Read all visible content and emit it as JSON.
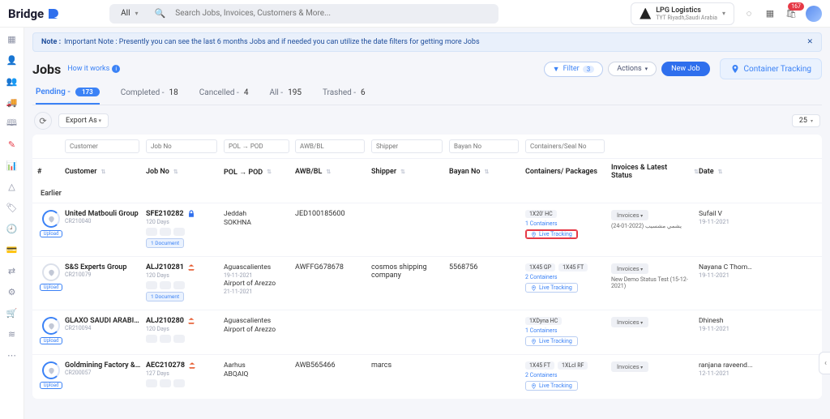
{
  "brand": "Bridge",
  "search": {
    "scope": "All",
    "placeholder": "Search Jobs, Invoices, Customers & More..."
  },
  "tenant": {
    "name": "LPG Logistics",
    "location": "TYT Riyadh,Saudi Arabia"
  },
  "notif_badge": "167",
  "notice": {
    "label": "Note :",
    "text": "Important Note : Presently you can see the last 6 months Jobs and if needed you can utilize the date filters for getting more Jobs"
  },
  "page_title": "Jobs",
  "how_it_works": "How it works",
  "filter": {
    "label": "Filter",
    "count": "3"
  },
  "actions_label": "Actions",
  "new_job": "New Job",
  "container_tracking": "Container Tracking",
  "tabs": {
    "pending": {
      "label": "Pending -",
      "count": "173"
    },
    "completed": {
      "label": "Completed -",
      "count": "18"
    },
    "cancelled": {
      "label": "Cancelled -",
      "count": "4"
    },
    "all": {
      "label": "All -",
      "count": "195"
    },
    "trashed": {
      "label": "Trashed -",
      "count": "6"
    }
  },
  "export_label": "Export As",
  "page_size": "25",
  "filters": {
    "customer": "Customer",
    "jobno": "Job No",
    "polpod": "POL → POD",
    "awb": "AWB/BL",
    "shipper": "Shipper",
    "bayan": "Bayan No",
    "container": "Containers/Seal No"
  },
  "columns": {
    "hash": "#",
    "customer": "Customer",
    "jobno": "Job No",
    "polpod": "POL → POD",
    "awb": "AWB/BL",
    "shipper": "Shipper",
    "bayan": "Bayan No",
    "containers": "Containers/ Packages",
    "invoices": "Invoices & Latest Status",
    "date": "Date"
  },
  "section_label": "Earlier",
  "upload_label": "Upload",
  "invoices_chip": "Invoices",
  "live_tracking": "Live Tracking",
  "doc_chip": "1 Document",
  "rows": [
    {
      "customer": "United Matbouli Group",
      "code": "CR210040",
      "jobno": "SFE210282",
      "mode": "sea-blue",
      "days": "120 Days",
      "pol": "Jeddah",
      "pod": "SOKHNA",
      "pol_sub": "",
      "awb": "JED100185600",
      "shipper": "",
      "bayan": "",
      "sizes": [
        "1X20' HC"
      ],
      "cont_count": "1 Containers",
      "lt_hl": true,
      "inv_sub": "يشمي مشسيب (2022-01-24)",
      "user": "Sufail V",
      "date": "19-11-2021",
      "doc": true,
      "ring_active": true
    },
    {
      "customer": "S&S Experts Group",
      "code": "CR210079",
      "jobno": "ALJ210281",
      "mode": "sea-red",
      "days": "120 Days",
      "pol": "Aguascalientes",
      "pod": "Airport of Arezzo",
      "pol_sub": "19-11-2021",
      "pod_sub": "21-11-2021",
      "awb": "AWFFG678678",
      "shipper": "cosmos shipping company",
      "bayan": "5568756",
      "sizes": [
        "1X45 GP",
        "1X45 FT"
      ],
      "cont_count": "2 Containers",
      "lt_hl": false,
      "inv_sub": "New Demo Status Test (15-12-2021)",
      "user": "Nayana C Thomas",
      "date": "19-11-2021",
      "doc": true,
      "ring_active": false
    },
    {
      "customer": "GLAXO SAUDI ARABIA L...",
      "code": "CR210094",
      "jobno": "ALJ210280",
      "mode": "sea-red",
      "days": "120 Days",
      "pol": "Aguascalientes",
      "pod": "Airport of Arezzo",
      "pol_sub": "",
      "awb": "",
      "shipper": "",
      "bayan": "",
      "sizes": [
        "1XDyna HC"
      ],
      "cont_count": "1 Containers",
      "lt_hl": false,
      "inv_sub": "",
      "user": "Dhinesh",
      "date": "19-11-2021",
      "doc": false,
      "ring_active": true
    },
    {
      "customer": "Goldmining Factory & P...",
      "code": "CR200057",
      "jobno": "AEC210278",
      "mode": "sea-red",
      "days": "127 Days",
      "pol": "Aarhus",
      "pod": "ABQAIQ",
      "pol_sub": "",
      "awb": "AWB565466",
      "shipper": "marcs",
      "bayan": "",
      "sizes": [
        "1X45 FT",
        "1XLcl RF"
      ],
      "cont_count": "2 Containers",
      "lt_hl": false,
      "inv_sub": "",
      "user": "ranjana raveend...",
      "date": "12-11-2021",
      "doc": false,
      "ring_active": true
    }
  ]
}
